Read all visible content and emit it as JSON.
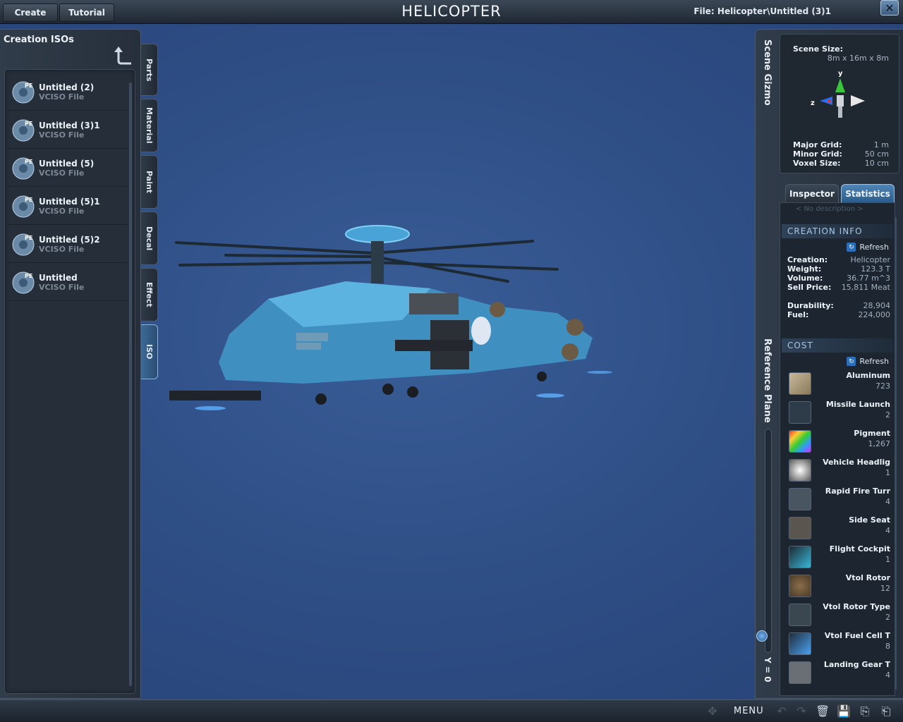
{
  "topbar": {
    "create_label": "Create",
    "tutorial_label": "Tutorial",
    "title": "HELICOPTER",
    "file_label": "File:",
    "file_path": "Helicopter\\Untitled (3)1",
    "close_label": "✕"
  },
  "left_panel": {
    "title": "Creation ISOs",
    "items": [
      {
        "name": "Untitled (2)",
        "type": "VCISO File",
        "badge": "PE"
      },
      {
        "name": "Untitled (3)1",
        "type": "VCISO File",
        "badge": "PE"
      },
      {
        "name": "Untitled (5)",
        "type": "VCISO File",
        "badge": "PE"
      },
      {
        "name": "Untitled (5)1",
        "type": "VCISO File",
        "badge": "PE"
      },
      {
        "name": "Untitled (5)2",
        "type": "VCISO File",
        "badge": "PE"
      },
      {
        "name": "Untitled",
        "type": "VCISO File",
        "badge": "PE"
      }
    ]
  },
  "side_tabs": [
    {
      "label": "Parts",
      "active": false
    },
    {
      "label": "Material",
      "active": false
    },
    {
      "label": "Paint",
      "active": false
    },
    {
      "label": "Decal",
      "active": false
    },
    {
      "label": "Effect",
      "active": false
    },
    {
      "label": "ISO",
      "active": true
    }
  ],
  "right_panel": {
    "scene_gizmo_label": "Scene Gizmo",
    "scene_size_label": "Scene Size:",
    "scene_size_value": "8m x 16m x 8m",
    "axis_y": "y",
    "axis_z": "z",
    "major_grid_label": "Major Grid:",
    "major_grid_value": "1 m",
    "minor_grid_label": "Minor Grid:",
    "minor_grid_value": "50 cm",
    "voxel_size_label": "Voxel Size:",
    "voxel_size_value": "10 cm",
    "reference_plane_label": "Reference Plane",
    "ref_value": "Y = 0",
    "ref_level": 0.0,
    "tabs": {
      "inspector": "Inspector",
      "statistics": "Statistics",
      "active": "statistics"
    },
    "no_description": "< No description >",
    "creation_info": {
      "header": "CREATION INFO",
      "refresh_label": "Refresh",
      "creation_label": "Creation:",
      "creation_value": "Helicopter",
      "weight_label": "Weight:",
      "weight_value": "123.3 T",
      "volume_label": "Volume:",
      "volume_value": "36.77 m^3",
      "sell_price_label": "Sell Price:",
      "sell_price_value": "15,811 Meat",
      "durability_label": "Durability:",
      "durability_value": "28,904",
      "fuel_label": "Fuel:",
      "fuel_value": "224,000"
    },
    "cost": {
      "header": "COST",
      "refresh_label": "Refresh",
      "items": [
        {
          "name": "Aluminum",
          "qty": "723"
        },
        {
          "name": "Missile Launch",
          "qty": "2"
        },
        {
          "name": "Pigment",
          "qty": "1,267"
        },
        {
          "name": "Vehicle Headlig",
          "qty": "1"
        },
        {
          "name": "Rapid Fire Turr",
          "qty": "4"
        },
        {
          "name": "Side Seat",
          "qty": "4"
        },
        {
          "name": "Flight Cockpit",
          "qty": "1"
        },
        {
          "name": "Vtol Rotor",
          "qty": "12"
        },
        {
          "name": "Vtol Rotor Type",
          "qty": "2"
        },
        {
          "name": "Vtol Fuel Cell T",
          "qty": "8"
        },
        {
          "name": "Landing Gear T",
          "qty": "4"
        }
      ]
    }
  },
  "bottombar": {
    "menu_label": "MENU"
  },
  "colors": {
    "viewport_bg": "#2f4f87",
    "accent": "#4f85b7",
    "helicopter_body": "#3f8fc1"
  }
}
